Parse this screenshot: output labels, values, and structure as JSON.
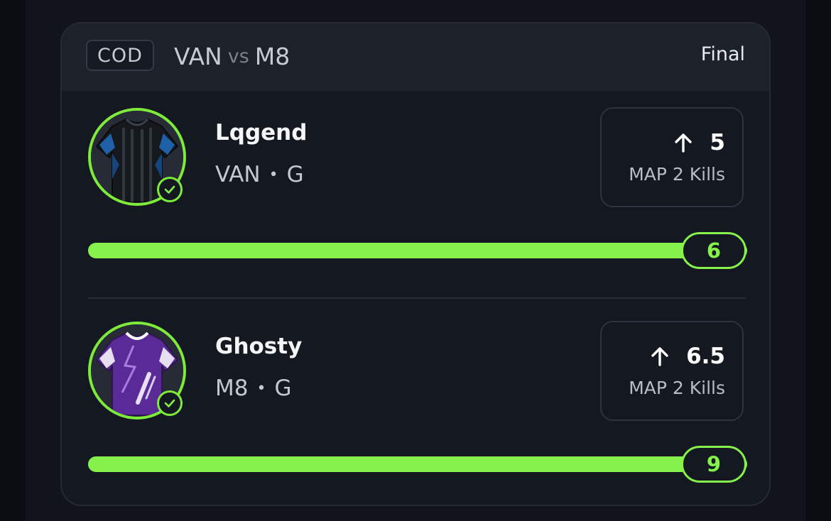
{
  "card": {
    "league": "COD",
    "team_a": "VAN",
    "vs_label": "vs",
    "team_b": "M8",
    "status": "Final"
  },
  "players": [
    {
      "name": "Lqgend",
      "team": "VAN",
      "separator": "•",
      "position": "G",
      "direction_icon": "arrow-up-icon",
      "line": "5",
      "stat": "MAP 2 Kills",
      "result": "6",
      "progress_fraction": 1.0,
      "jersey_icon": "jersey-black-blue-icon"
    },
    {
      "name": "Ghosty",
      "team": "M8",
      "separator": "•",
      "position": "G",
      "direction_icon": "arrow-up-icon",
      "line": "6.5",
      "stat": "MAP 2 Kills",
      "result": "9",
      "progress_fraction": 1.0,
      "jersey_icon": "jersey-purple-icon"
    }
  ],
  "colors": {
    "accent": "#86f14a",
    "card_bg": "#141821",
    "header_bg": "#1d212a"
  }
}
